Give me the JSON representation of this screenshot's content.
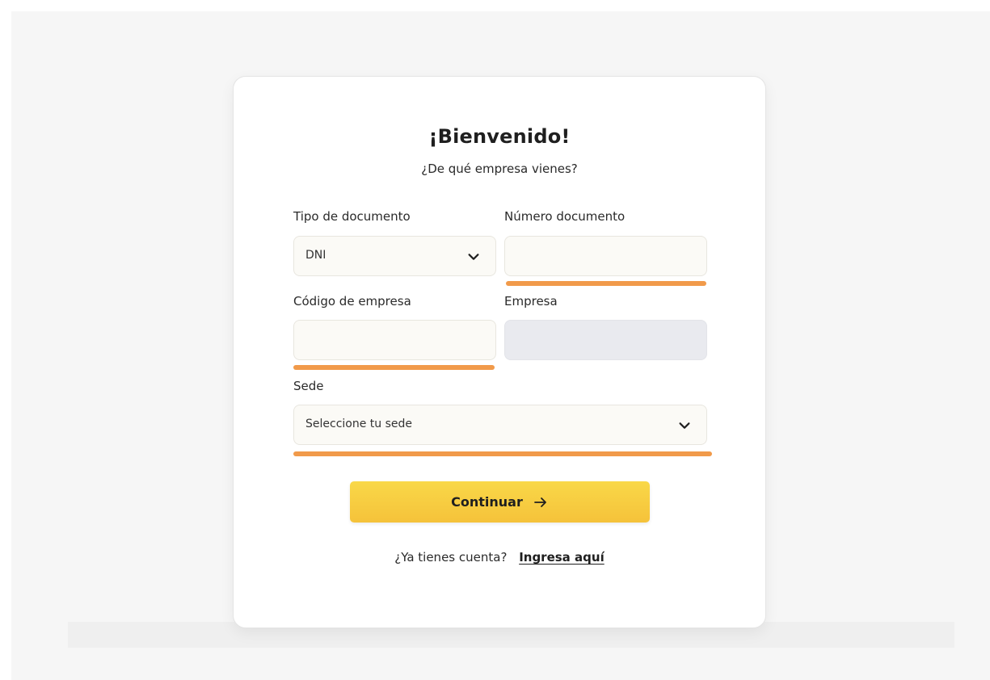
{
  "header": {
    "title": "¡Bienvenido!",
    "subtitle": "¿De qué empresa vienes?"
  },
  "form": {
    "document_type": {
      "label": "Tipo de documento",
      "selected": "DNI"
    },
    "document_number": {
      "label": "Número documento",
      "value": ""
    },
    "company_code": {
      "label": "Código de empresa",
      "value": ""
    },
    "company": {
      "label": "Empresa",
      "value": ""
    },
    "site": {
      "label": "Sede",
      "placeholder": "Seleccione tu sede"
    }
  },
  "actions": {
    "continue_label": "Continuar"
  },
  "footer": {
    "question": "¿Ya tienes cuenta?",
    "login_link": "Ingresa aquí"
  },
  "colors": {
    "accent": "#f5c23a",
    "highlight_underline": "#f19a4a",
    "disabled_field": "#e9eaef"
  },
  "icons": {
    "select_chevron": "chevron-down-icon",
    "continue_arrow": "arrow-right-icon"
  }
}
